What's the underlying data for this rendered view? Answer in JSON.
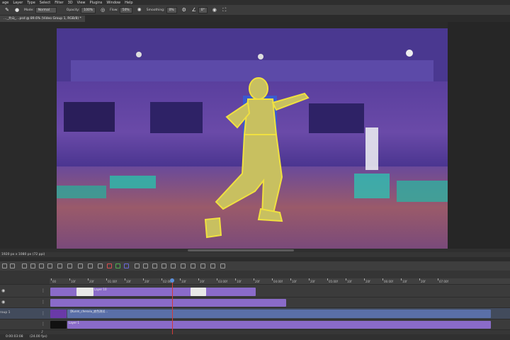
{
  "menu": [
    "age",
    "Layer",
    "Type",
    "Select",
    "Filter",
    "3D",
    "View",
    "Plugins",
    "Window",
    "Help"
  ],
  "options": {
    "mode_label": "Mode:",
    "mode_value": "Normal",
    "opacity_label": "Opacity:",
    "opacity_value": "100%",
    "flow_label": "Flow:",
    "flow_value": "50%",
    "smoothing_label": "Smoothing:",
    "smoothing_value": "0%",
    "angle_value": "0°"
  },
  "document": {
    "tab_title": "…_大山_…psd @ 89.6% (Video Group 1, RGB/8) *"
  },
  "status": {
    "text": "1920 px x 1080 px (72 ppi)"
  },
  "timeline": {
    "ruler_labels": [
      "00",
      "10f",
      "20f",
      "01:00f",
      "10f",
      "20f",
      "02:00f",
      "10f",
      "20f",
      "03:00f",
      "10f",
      "20f",
      "04:00f",
      "10f",
      "20f",
      "05:00f",
      "10f",
      "20f",
      "06:00f",
      "10f",
      "20f",
      "07:00f"
    ],
    "tracks": [
      {
        "name": "Layer 10",
        "label": "Layer 10"
      },
      {
        "name": "",
        "label": ""
      },
      {
        "name": "Video Group 1",
        "label": "【Kunm_chenxiu_底色测试…"
      },
      {
        "name": "",
        "label": "Layer 1"
      }
    ],
    "group_label": "roup 1",
    "timecode": "0:00:03:08",
    "fps": "(24.00 fps)"
  },
  "colors": {
    "accent_clip": "#8a6bc9",
    "video_clip": "#5a6fa8",
    "playhead": "#d23a3a"
  }
}
